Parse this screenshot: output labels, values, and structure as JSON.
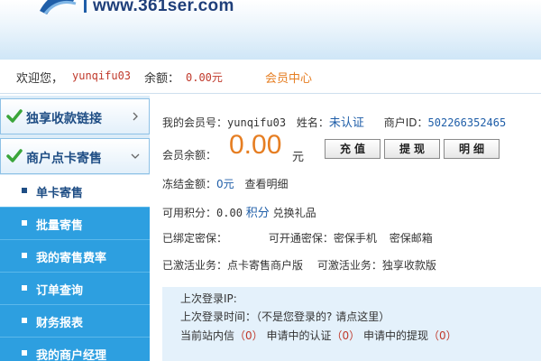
{
  "header": {
    "site_url": "www.361ser.com"
  },
  "welcome": {
    "label": "欢迎您，",
    "username": "yunqifu03",
    "balance_label": "余额：",
    "balance_value": "0.00元",
    "member_center": "会员中心"
  },
  "sidebar": {
    "heads": [
      {
        "label": "独享收款链接",
        "expanded": false
      },
      {
        "label": "商户点卡寄售",
        "expanded": true
      }
    ],
    "items": [
      {
        "label": "单卡寄售",
        "active": true
      },
      {
        "label": "批量寄售",
        "active": false
      },
      {
        "label": "我的寄售费率",
        "active": false
      },
      {
        "label": "订单查询",
        "active": false
      },
      {
        "label": "财务报表",
        "active": false
      },
      {
        "label": "我的商户经理",
        "active": false
      }
    ]
  },
  "main": {
    "member_no_label": "我的会员号：",
    "member_no": "yunqifu03",
    "name_label": "姓名：",
    "name_value": "未认证",
    "merchant_id_label": "商户ID：",
    "merchant_id": "502266352465",
    "balance_label": "会员余额：",
    "balance_value": "0.00",
    "balance_unit": "元",
    "buttons": {
      "recharge": "充值",
      "withdraw": "提现",
      "detail": "明细"
    },
    "frozen_label": "冻结金额：",
    "frozen_value": "0元",
    "frozen_link": "查看明细",
    "points_label": "可用积分：",
    "points_value": "0.00",
    "points_unit": "积分",
    "points_link": "兑换礼品",
    "bound_security_label": "已绑定密保：",
    "available_security_label": "可开通密保：",
    "security_phone": "密保手机",
    "security_email": "密保邮箱",
    "activated_label": "已激活业务：",
    "activated_value": "点卡寄售商户版",
    "activatable_label": "可激活业务：",
    "activatable_value": "独享收款版"
  },
  "info": {
    "last_ip_label": "上次登录IP:",
    "last_time_label": "上次登录时间：",
    "not_you_text": "（不是您登录的? 请点这里）",
    "messages_label": "当前站内信",
    "messages_count": "（0）",
    "verify_label": "申请中的认证",
    "verify_count": "（0）",
    "withdraw_label": "申请中的提现",
    "withdraw_count": "（0）"
  },
  "colors": {
    "sidebar_active_bg": "#2d9fe0",
    "accent_orange": "#e67e22",
    "accent_red": "#c0392b",
    "nav_blue": "#1f4e85"
  }
}
